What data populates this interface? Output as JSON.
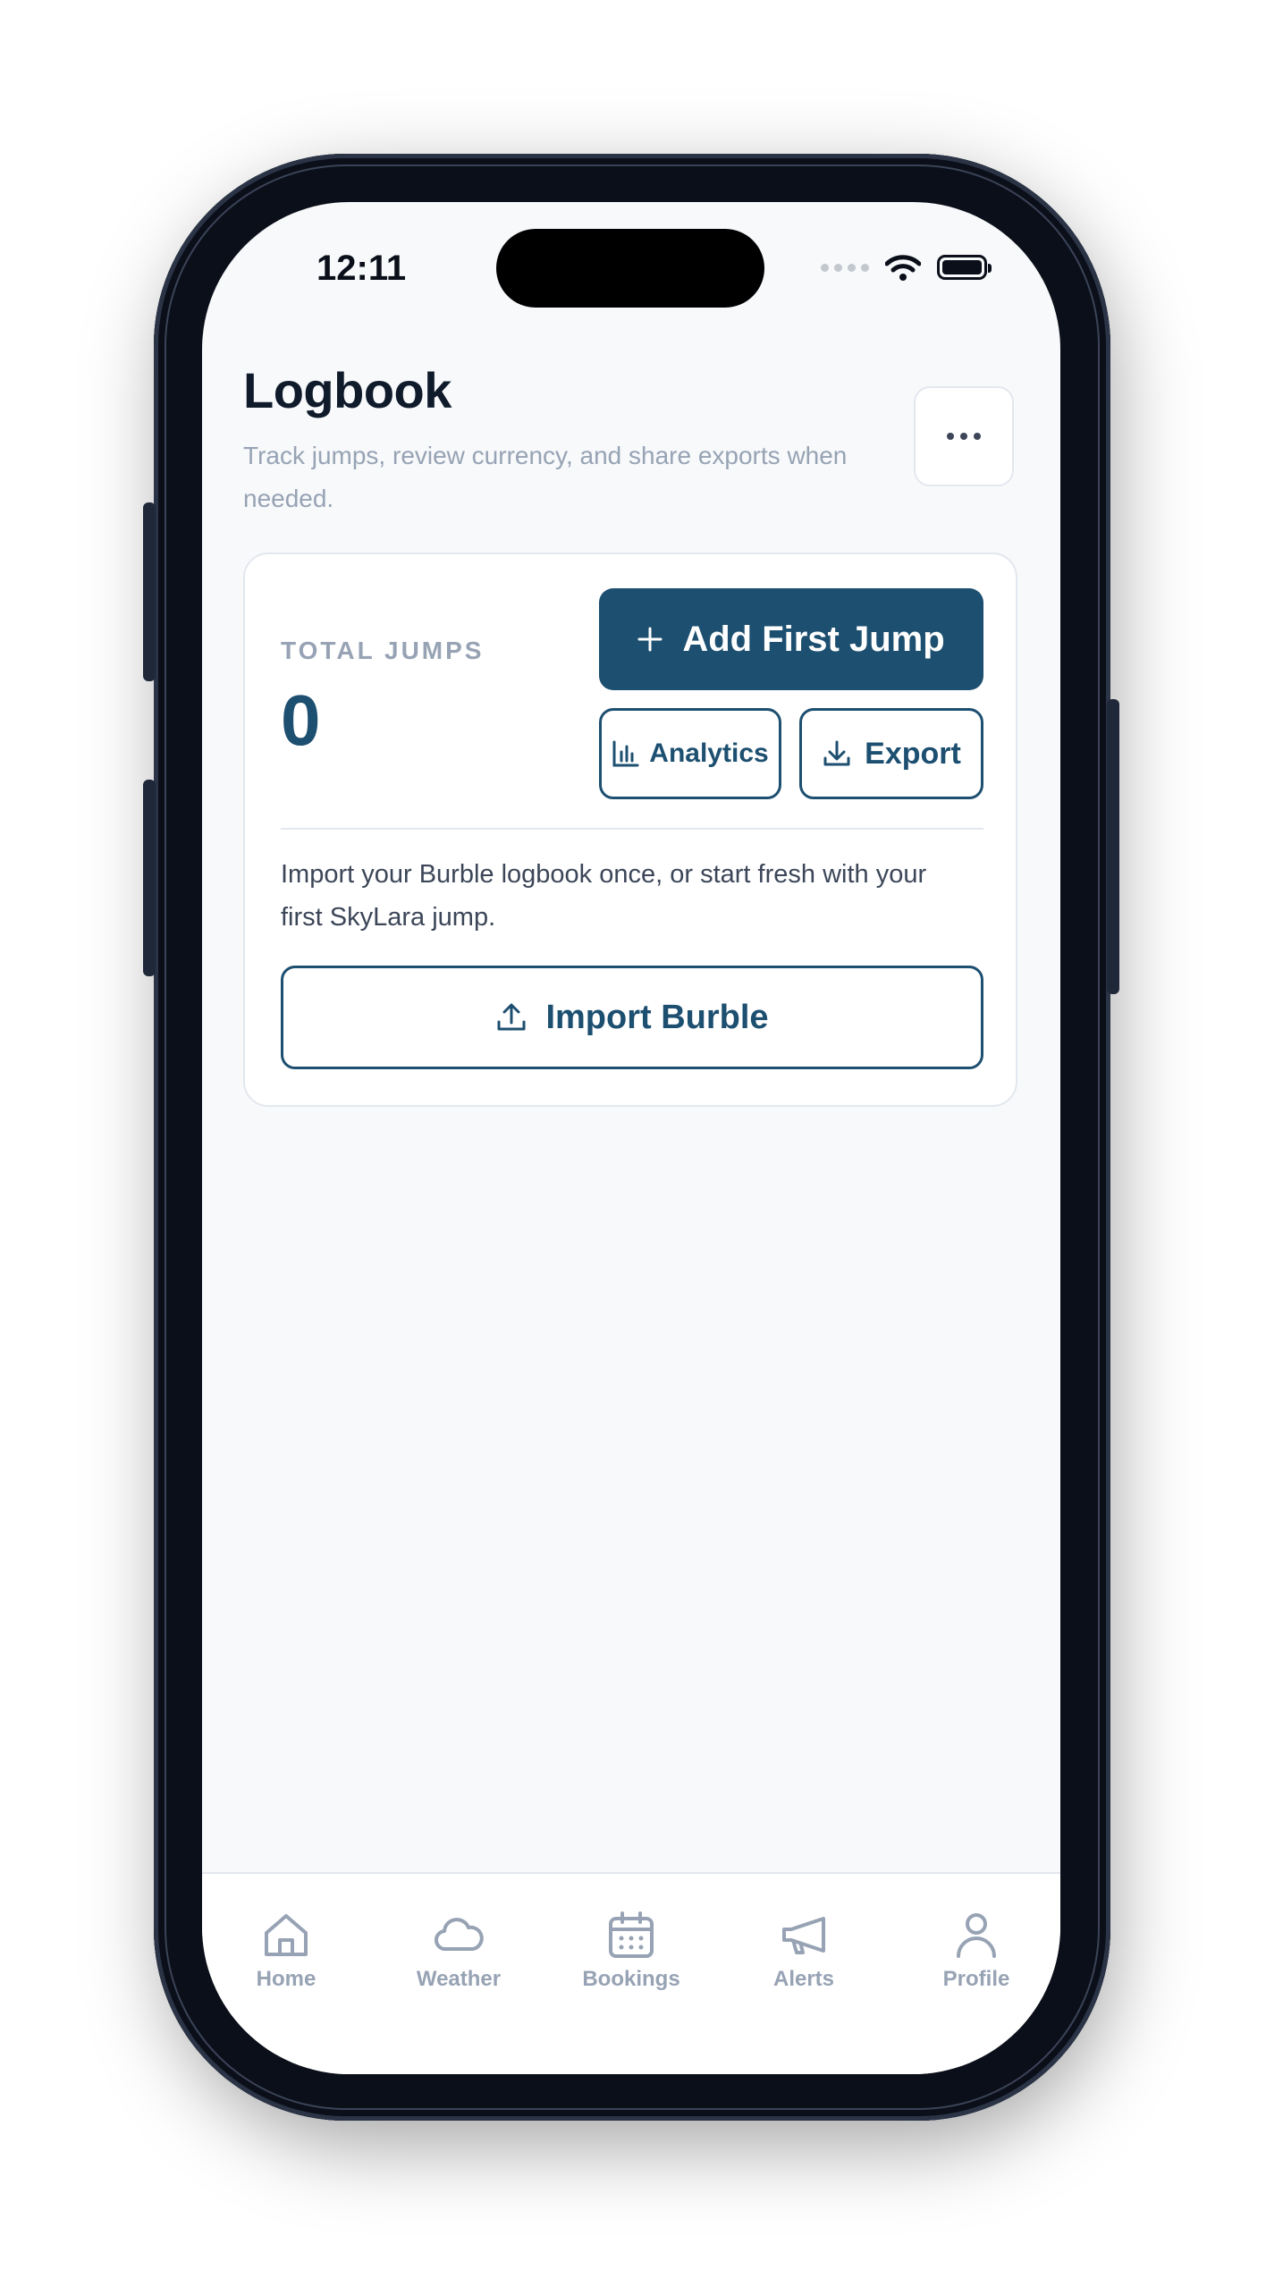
{
  "status_bar": {
    "time": "12:11"
  },
  "header": {
    "title": "Logbook",
    "subtitle": "Track jumps, review currency, and share exports when needed."
  },
  "summary_card": {
    "total_label": "TOTAL JUMPS",
    "total_value": "0",
    "add_first_jump_label": "Add First Jump",
    "analytics_label": "Analytics",
    "export_label": "Export",
    "import_text": "Import your Burble logbook once, or start fresh with your first SkyLara jump.",
    "import_button_label": "Import Burble"
  },
  "tab_bar": {
    "items": [
      {
        "label": "Home",
        "icon": "home-icon"
      },
      {
        "label": "Weather",
        "icon": "cloud-icon"
      },
      {
        "label": "Bookings",
        "icon": "calendar-icon"
      },
      {
        "label": "Alerts",
        "icon": "megaphone-icon"
      },
      {
        "label": "Profile",
        "icon": "person-icon"
      }
    ]
  },
  "colors": {
    "primary": "#1d4f70",
    "muted_text": "#97a3b4",
    "title_text": "#0f1a2b",
    "body_text": "#3c4658",
    "background": "#f7f9fb"
  }
}
